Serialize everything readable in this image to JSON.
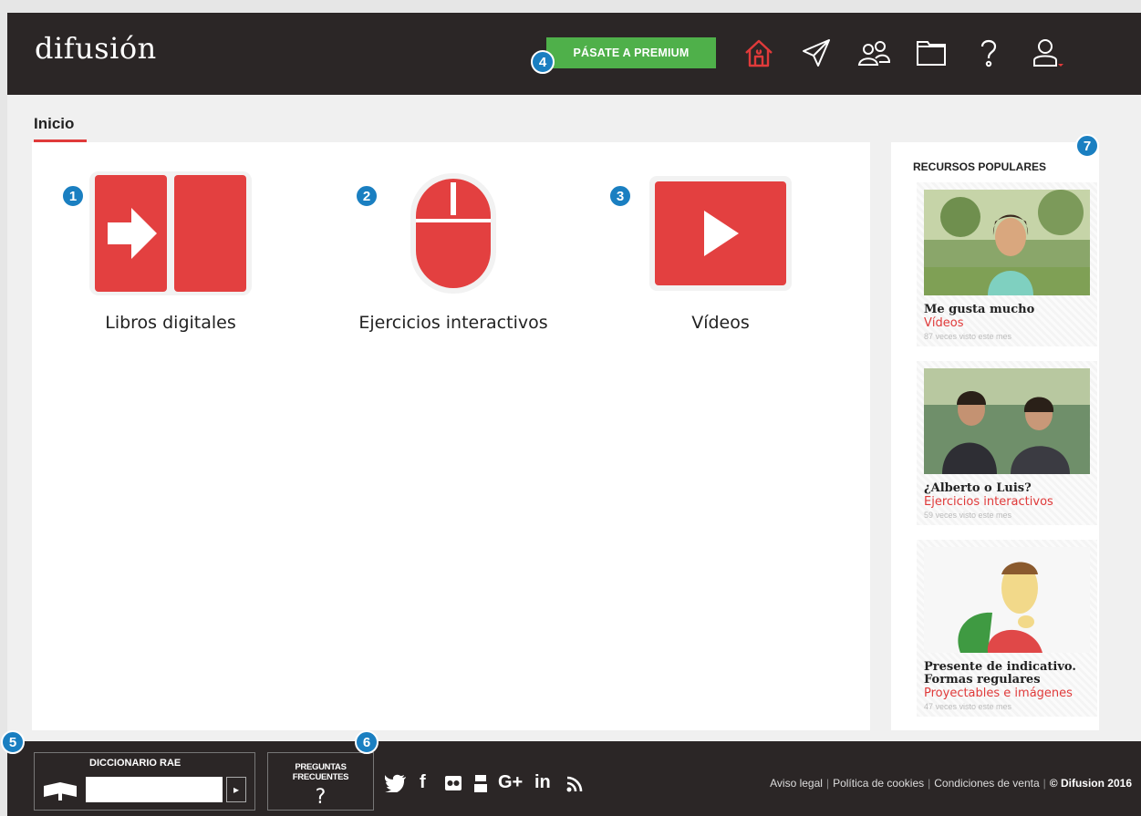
{
  "header": {
    "logo": "difusión",
    "premium_label": "PÁSATE A PREMIUM",
    "nav_icons": [
      "home-icon",
      "send-icon",
      "users-icon",
      "folder-icon",
      "help-icon",
      "user-icon"
    ]
  },
  "breadcrumb": "Inicio",
  "tiles": [
    {
      "label": "Libros digitales",
      "icon": "book-arrow-icon"
    },
    {
      "label": "Ejercicios interactivos",
      "icon": "mouse-icon"
    },
    {
      "label": "Vídeos",
      "icon": "play-icon"
    }
  ],
  "sidebar": {
    "title": "RECURSOS POPULARES",
    "items": [
      {
        "title": "Me gusta mucho",
        "category": "Vídeos",
        "views": "87 veces visto este mes"
      },
      {
        "title": "¿Alberto o Luis?",
        "category": "Ejercicios interactivos",
        "views": "59 veces visto este mes"
      },
      {
        "title": "Presente de indicativo. Formas regulares",
        "category": "Proyectables e imágenes",
        "views": "47 veces visto este mes"
      }
    ]
  },
  "footer": {
    "dict_title": "DICCIONARIO RAE",
    "faq_title": "PREGUNTAS FRECUENTES",
    "faq_glyph": "?",
    "social": [
      "twitter-icon",
      "facebook-icon",
      "flickr-icon",
      "youtube-icon",
      "googleplus-icon",
      "linkedin-icon",
      "rss-icon"
    ],
    "social_text": {
      "facebook": "f",
      "googleplus": "G+",
      "linkedin": "in"
    },
    "legal": [
      "Aviso legal",
      "Política de cookies",
      "Condiciones de venta"
    ],
    "copyright": "© Difusion 2016"
  },
  "badges": [
    "1",
    "2",
    "3",
    "4",
    "5",
    "6",
    "7"
  ],
  "colors": {
    "accent": "#e03a3a",
    "premium": "#4fb04a",
    "header": "#2b2626",
    "badge": "#1a7fc1"
  }
}
